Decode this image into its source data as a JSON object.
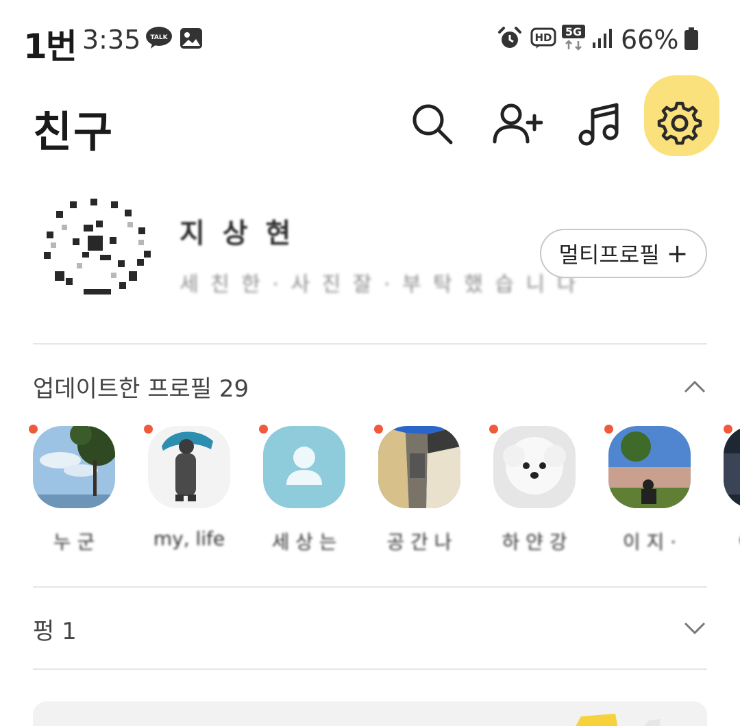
{
  "status_bar": {
    "carrier": "1번",
    "time": "3:35",
    "talk_badge": "TALK",
    "hd": "HD",
    "network": "5G",
    "battery": "66%",
    "icons": [
      "kakaotalk-notification-icon",
      "gallery-icon",
      "alarm-icon",
      "hd-voice-icon",
      "5g-icon",
      "signal-icon",
      "battery-icon"
    ]
  },
  "header": {
    "title": "친구",
    "icons": [
      "search-icon",
      "add-friend-icon",
      "music-icon",
      "settings-icon"
    ],
    "highlight_color": "#fbe17c"
  },
  "my_profile": {
    "name": "지 상 현",
    "status": "세 친 한 · 사 진 잘 · 부 탁 했 습 니 다",
    "multi_profile_label": "멀티프로필",
    "multi_profile_plus": "+"
  },
  "updated_profiles": {
    "title": "업데이트한 프로필 29",
    "new_dot_color": "#f05a3c",
    "items": [
      {
        "name": "누 군",
        "image": "sky-tree"
      },
      {
        "name": "my, life",
        "image": "umbrella"
      },
      {
        "name": "세 상 는",
        "image": "default"
      },
      {
        "name": "공 간 나",
        "image": "alley"
      },
      {
        "name": "하 얀 강",
        "image": "dog"
      },
      {
        "name": "이 지 ·",
        "image": "field"
      },
      {
        "name": "c",
        "image": "dark"
      }
    ]
  },
  "pinned": {
    "title": "펑 1"
  }
}
